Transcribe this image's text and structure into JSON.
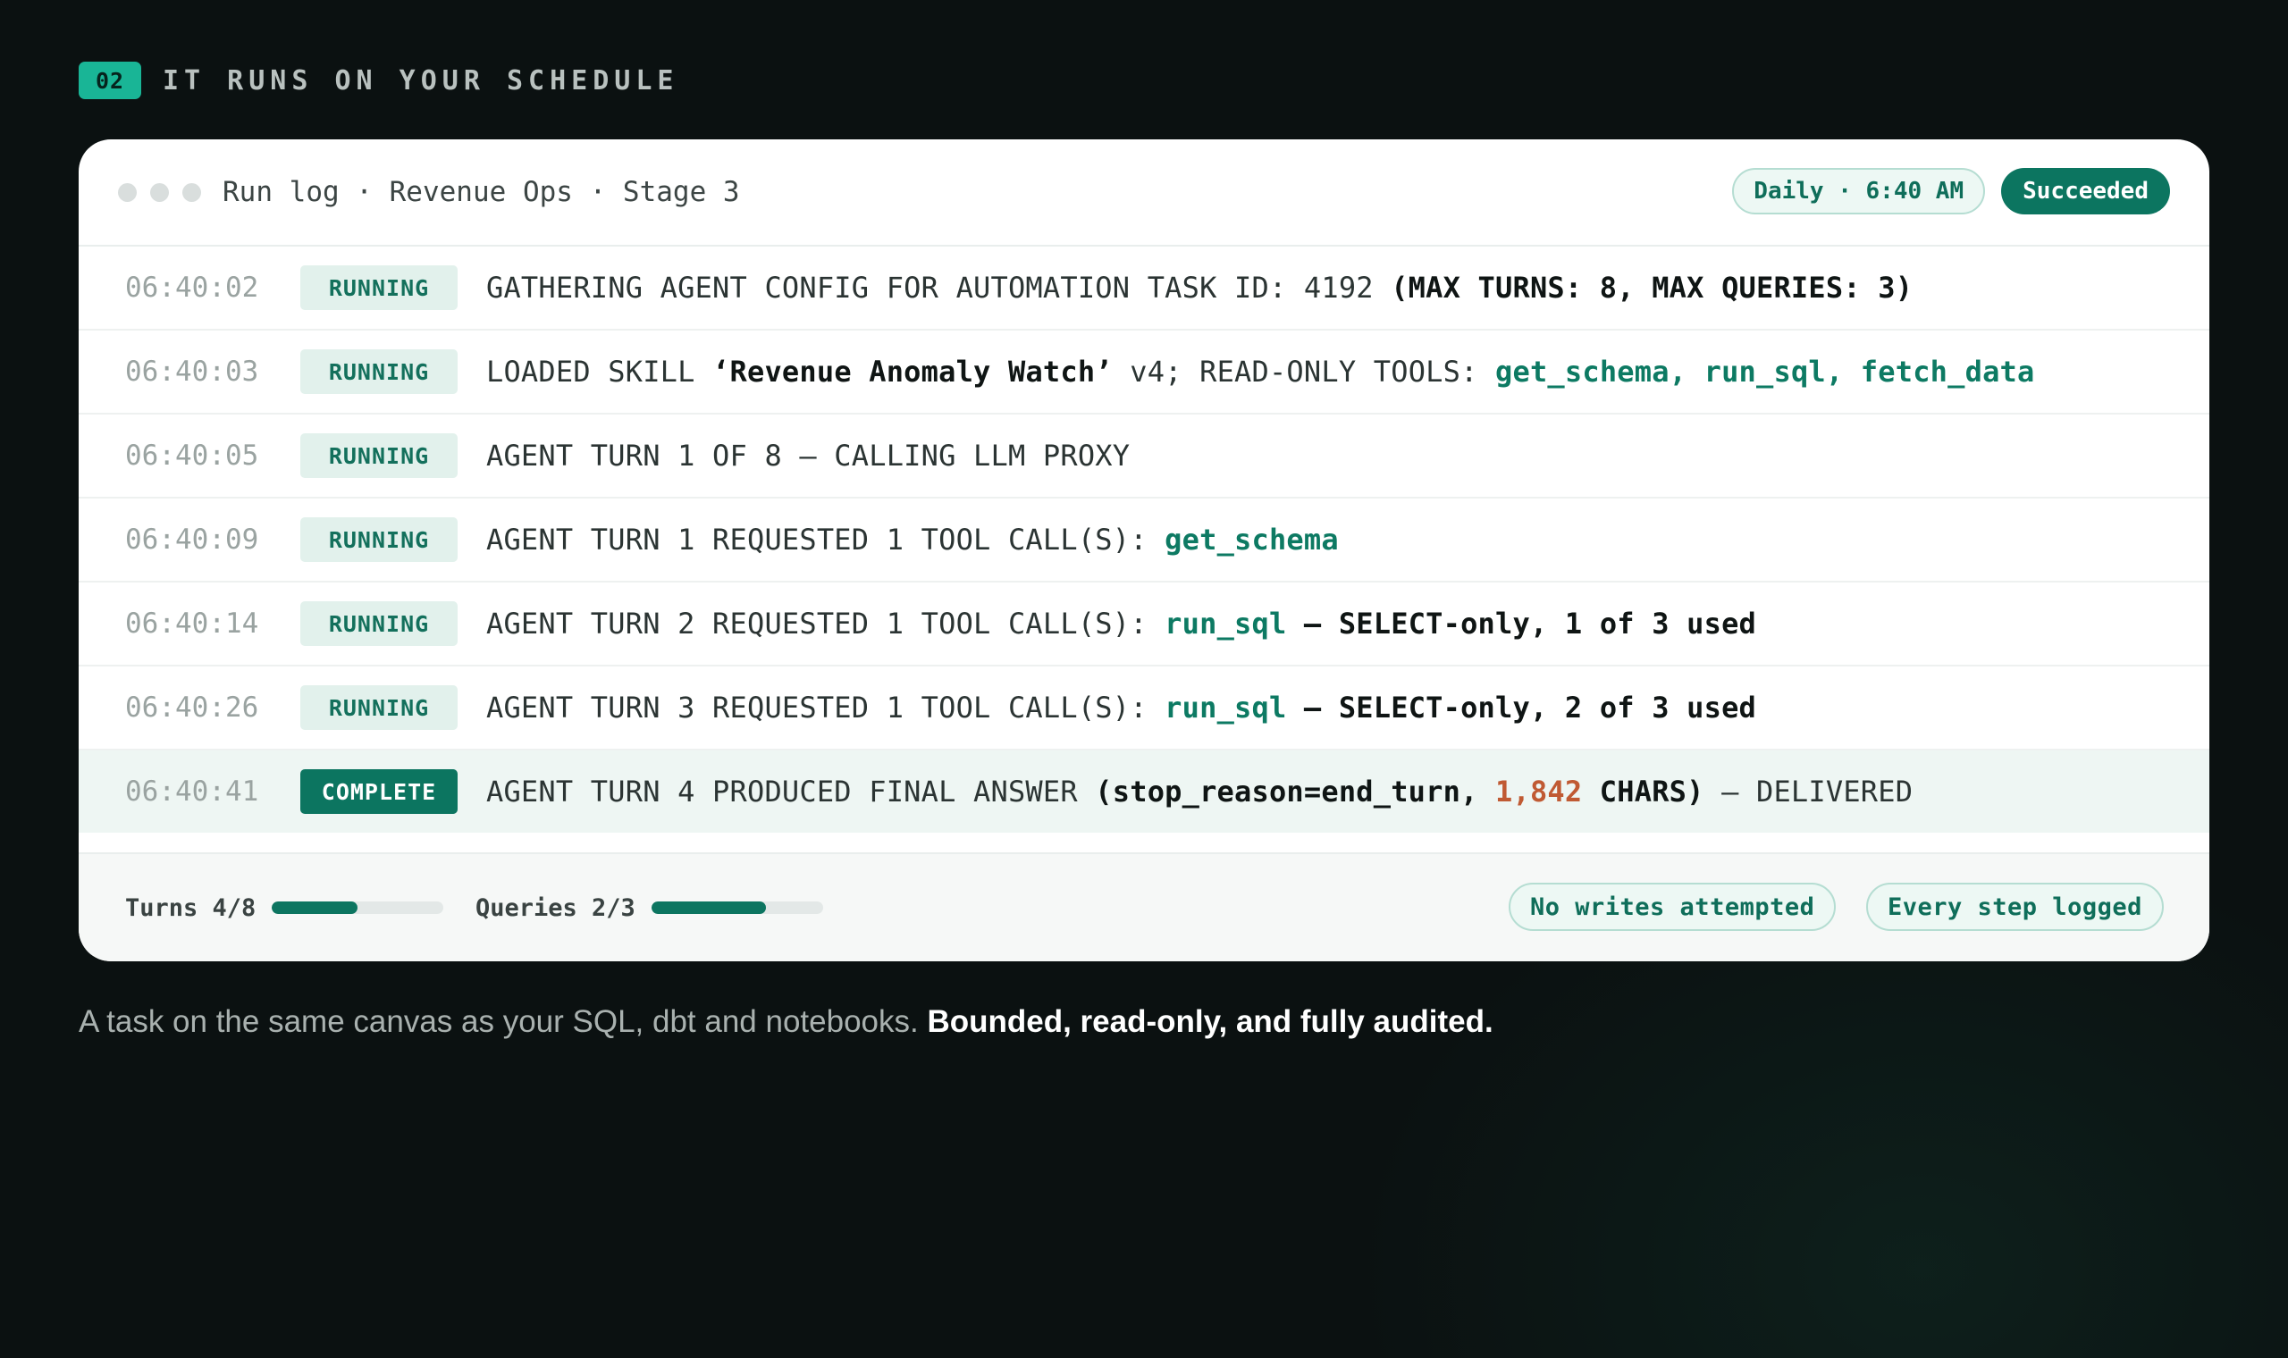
{
  "section": {
    "number": "02",
    "title": "IT RUNS ON YOUR SCHEDULE"
  },
  "window": {
    "title": "Run log · Revenue Ops · Stage 3",
    "schedule": "Daily · 6:40 AM",
    "status": "Succeeded"
  },
  "logs": [
    {
      "time": "06:40:02",
      "status": "RUNNING",
      "parts": [
        {
          "text": "GATHERING AGENT CONFIG FOR AUTOMATION TASK ID: 4192 ",
          "style": "plain"
        },
        {
          "text": "(MAX TURNS: 8, MAX QUERIES: 3)",
          "style": "bold"
        }
      ]
    },
    {
      "time": "06:40:03",
      "status": "RUNNING",
      "parts": [
        {
          "text": "LOADED SKILL ",
          "style": "plain"
        },
        {
          "text": "‘Revenue Anomaly Watch’",
          "style": "bold"
        },
        {
          "text": " v4; READ-ONLY TOOLS: ",
          "style": "plain"
        },
        {
          "text": "get_schema, run_sql, fetch_data",
          "style": "tool"
        }
      ]
    },
    {
      "time": "06:40:05",
      "status": "RUNNING",
      "parts": [
        {
          "text": "AGENT TURN 1 OF 8 — CALLING LLM PROXY",
          "style": "plain"
        }
      ]
    },
    {
      "time": "06:40:09",
      "status": "RUNNING",
      "parts": [
        {
          "text": "AGENT TURN 1 REQUESTED 1 TOOL CALL(S): ",
          "style": "plain"
        },
        {
          "text": "get_schema",
          "style": "tool"
        }
      ]
    },
    {
      "time": "06:40:14",
      "status": "RUNNING",
      "parts": [
        {
          "text": "AGENT TURN 2 REQUESTED 1 TOOL CALL(S): ",
          "style": "plain"
        },
        {
          "text": "run_sql",
          "style": "tool"
        },
        {
          "text": " — SELECT-only, 1 of 3 used",
          "style": "bold"
        }
      ]
    },
    {
      "time": "06:40:26",
      "status": "RUNNING",
      "parts": [
        {
          "text": "AGENT TURN 3 REQUESTED 1 TOOL CALL(S): ",
          "style": "plain"
        },
        {
          "text": "run_sql",
          "style": "tool"
        },
        {
          "text": " — SELECT-only, 2 of 3 used",
          "style": "bold"
        }
      ]
    },
    {
      "time": "06:40:41",
      "status": "COMPLETE",
      "parts": [
        {
          "text": "AGENT TURN 4 PRODUCED FINAL ANSWER ",
          "style": "plain"
        },
        {
          "text": "(stop_reason=end_turn, ",
          "style": "bold"
        },
        {
          "text": "1,842",
          "style": "num"
        },
        {
          "text": " CHARS)",
          "style": "bold"
        },
        {
          "text": " — DELIVERED",
          "style": "plain"
        }
      ]
    }
  ],
  "footer": {
    "turns": {
      "label": "Turns 4/8",
      "fraction": 0.5
    },
    "queries": {
      "label": "Queries 2/3",
      "fraction": 0.667
    },
    "badges": [
      "No writes attempted",
      "Every step logged"
    ]
  },
  "caption": {
    "lead": "A task on the same canvas as your SQL, dbt and notebooks. ",
    "emphasis": "Bounded, read-only, and fully audited."
  }
}
